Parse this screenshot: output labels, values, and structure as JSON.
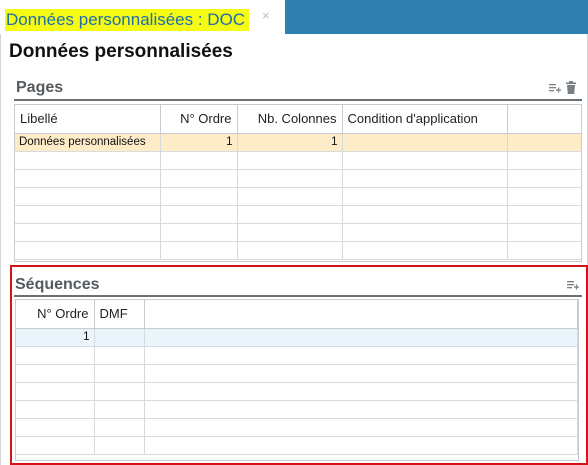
{
  "tab": {
    "title": "Données personnalisées : DOC",
    "close_glyph": "×"
  },
  "page": {
    "title": "Données personnalisées"
  },
  "pages_section": {
    "title": "Pages",
    "columns": [
      "Libellé",
      "N° Ordre",
      "Nb. Colonnes",
      "Condition d'application",
      ""
    ],
    "rows": [
      {
        "libelle": "Données personnalisées",
        "ordre": "1",
        "colonnes": "1",
        "condition": ""
      }
    ],
    "empty_rows": 6,
    "icons": [
      "add-row-icon",
      "delete-icon"
    ]
  },
  "sequences_section": {
    "title": "Séquences",
    "columns": [
      "N° Ordre",
      "DMF",
      ""
    ],
    "rows": [
      {
        "ordre": "1",
        "dmf": ""
      }
    ],
    "empty_rows": 6,
    "icons": [
      "add-row-icon"
    ]
  },
  "colors": {
    "tabbar": "#2f7fb1",
    "tab_highlight": "#f5fb12",
    "selected_row_pages": "#fdecc7",
    "selected_row_sequences": "#eaf4fb",
    "annotation_box": "#d2141a"
  }
}
